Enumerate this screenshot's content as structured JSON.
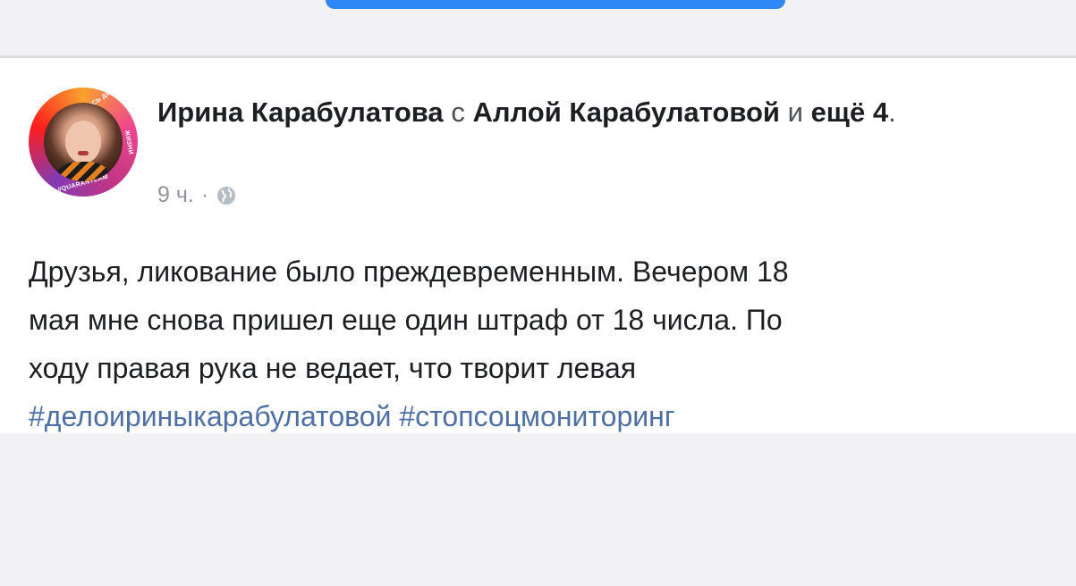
{
  "post": {
    "author": "Ирина Карабулатова",
    "with_word": "с",
    "tagged_person": "Аллой Карабулатовой",
    "and_word": "и",
    "others": "ещё 4",
    "period": ".",
    "time": "9 ч.",
    "separator": "·",
    "privacy_icon": "globe-icon",
    "text_line1": "Друзья, ликование было преждевременным. Вечером 18",
    "text_line2": "мая мне снова пришел еще один штраф от 18 числа. По",
    "text_line3": "ходу правая рука не ведает, что творит левая",
    "hashtags": [
      "#делоириныкарабулатовой",
      "#стопсоцмониторинг"
    ]
  },
  "avatar": {
    "ring_text_top": "ОСТАВАЙТЕСЬ ДОМА · СПАСИТЕ",
    "ring_text_right": "ЖИЗНИ",
    "ring_text_bottom": "#QUARANTEAM"
  },
  "colors": {
    "accent": "#2d88f5",
    "hashtag": "#4e6fa3",
    "meta": "#90949c"
  }
}
